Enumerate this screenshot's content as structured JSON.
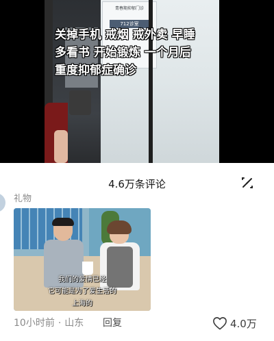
{
  "video": {
    "caption_lines": [
      "关掉手机 戒烟 戒外卖 早睡",
      "多看书  开始锻炼 一个月后",
      "重度抑郁症确诊"
    ],
    "sign_text": "青春期抑郁门诊",
    "room_label": "712诊室"
  },
  "comments": {
    "title": "4.6万条评论",
    "items": [
      {
        "username": "礼物",
        "image_subtitles": [
          "我们的爱情已经",
          "它可能是为了爱生活的",
          "上海的"
        ],
        "time": "10小时前",
        "location": "山东",
        "reply_label": "回复",
        "like_count": "4.0万"
      }
    ]
  },
  "icons": {
    "collapse": "collapse-icon",
    "like": "heart-outline-icon"
  }
}
